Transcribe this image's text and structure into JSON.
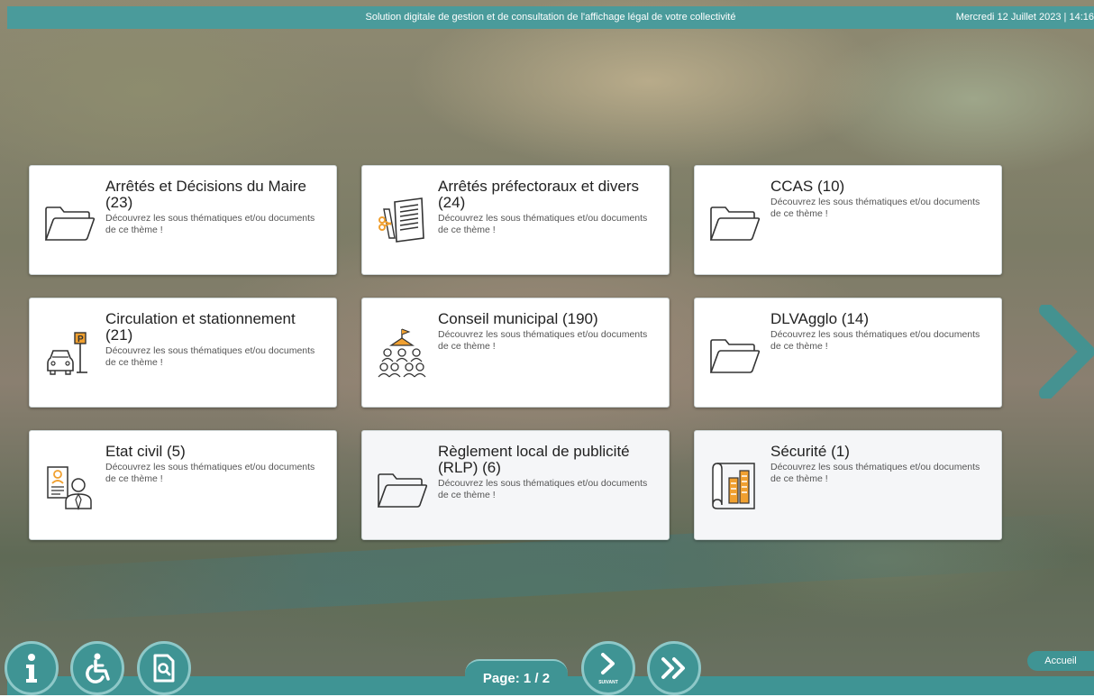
{
  "header": {
    "title": "Solution digitale de gestion et de consultation de l'affichage légal de votre collectivité",
    "date": "Mercredi 12 Juillet 2023 | 14:16"
  },
  "cards": [
    {
      "title": "Arrêtés et Décisions du Maire (23)",
      "desc": "Découvrez les sous thématiques et/ou documents de ce thème !",
      "icon": "folder-icon"
    },
    {
      "title": "Arrêtés préfectoraux et divers (24)",
      "desc": "Découvrez les sous thématiques et/ou documents de ce thème !",
      "icon": "document-scissors-icon"
    },
    {
      "title": "CCAS (10)",
      "desc": "Découvrez les sous thématiques et/ou documents de ce thème !",
      "icon": "folder-icon"
    },
    {
      "title": "Circulation et stationnement (21)",
      "desc": "Découvrez les sous thématiques et/ou documents de ce thème !",
      "icon": "car-parking-icon"
    },
    {
      "title": "Conseil municipal (190)",
      "desc": "Découvrez les sous thématiques et/ou documents de ce thème !",
      "icon": "council-meeting-icon"
    },
    {
      "title": "DLVAgglo (14)",
      "desc": "Découvrez les sous thématiques et/ou documents de ce thème !",
      "icon": "folder-icon"
    },
    {
      "title": "Etat civil (5)",
      "desc": "Découvrez les sous thématiques et/ou documents de ce thème !",
      "icon": "id-card-person-icon"
    },
    {
      "title": "Règlement local de publicité (RLP) (6)",
      "desc": "Découvrez les sous thématiques et/ou documents de ce thème !",
      "icon": "folder-icon"
    },
    {
      "title": "Sécurité (1)",
      "desc": "Découvrez les sous thématiques et/ou documents de ce thème !",
      "icon": "building-plan-icon"
    }
  ],
  "footer": {
    "page_label": "Page: 1 / 2",
    "suivant_label": "SUIVANT",
    "accueil_label": "Accueil"
  },
  "colors": {
    "accent": "#4a9b9b",
    "accent_light": "#8ec8c8",
    "icon_orange": "#f0a030"
  }
}
